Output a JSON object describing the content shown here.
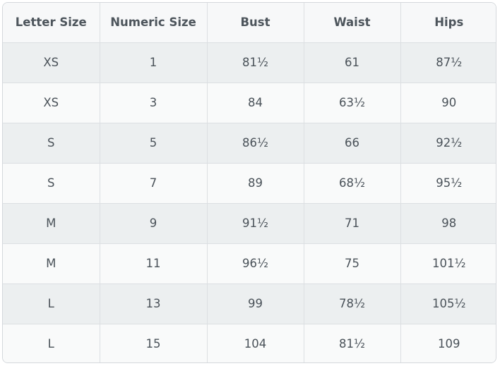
{
  "table": {
    "headers": [
      "Letter Size",
      "Numeric Size",
      "Bust",
      "Waist",
      "Hips"
    ],
    "rows": [
      [
        "XS",
        "1",
        "81½",
        "61",
        "87½"
      ],
      [
        "XS",
        "3",
        "84",
        "63½",
        "90"
      ],
      [
        "S",
        "5",
        "86½",
        "66",
        "92½"
      ],
      [
        "S",
        "7",
        "89",
        "68½",
        "95½"
      ],
      [
        "M",
        "9",
        "91½",
        "71",
        "98"
      ],
      [
        "M",
        "11",
        "96½",
        "75",
        "101½"
      ],
      [
        "L",
        "13",
        "99",
        "78½",
        "105½"
      ],
      [
        "L",
        "15",
        "104",
        "81½",
        "109"
      ]
    ]
  }
}
